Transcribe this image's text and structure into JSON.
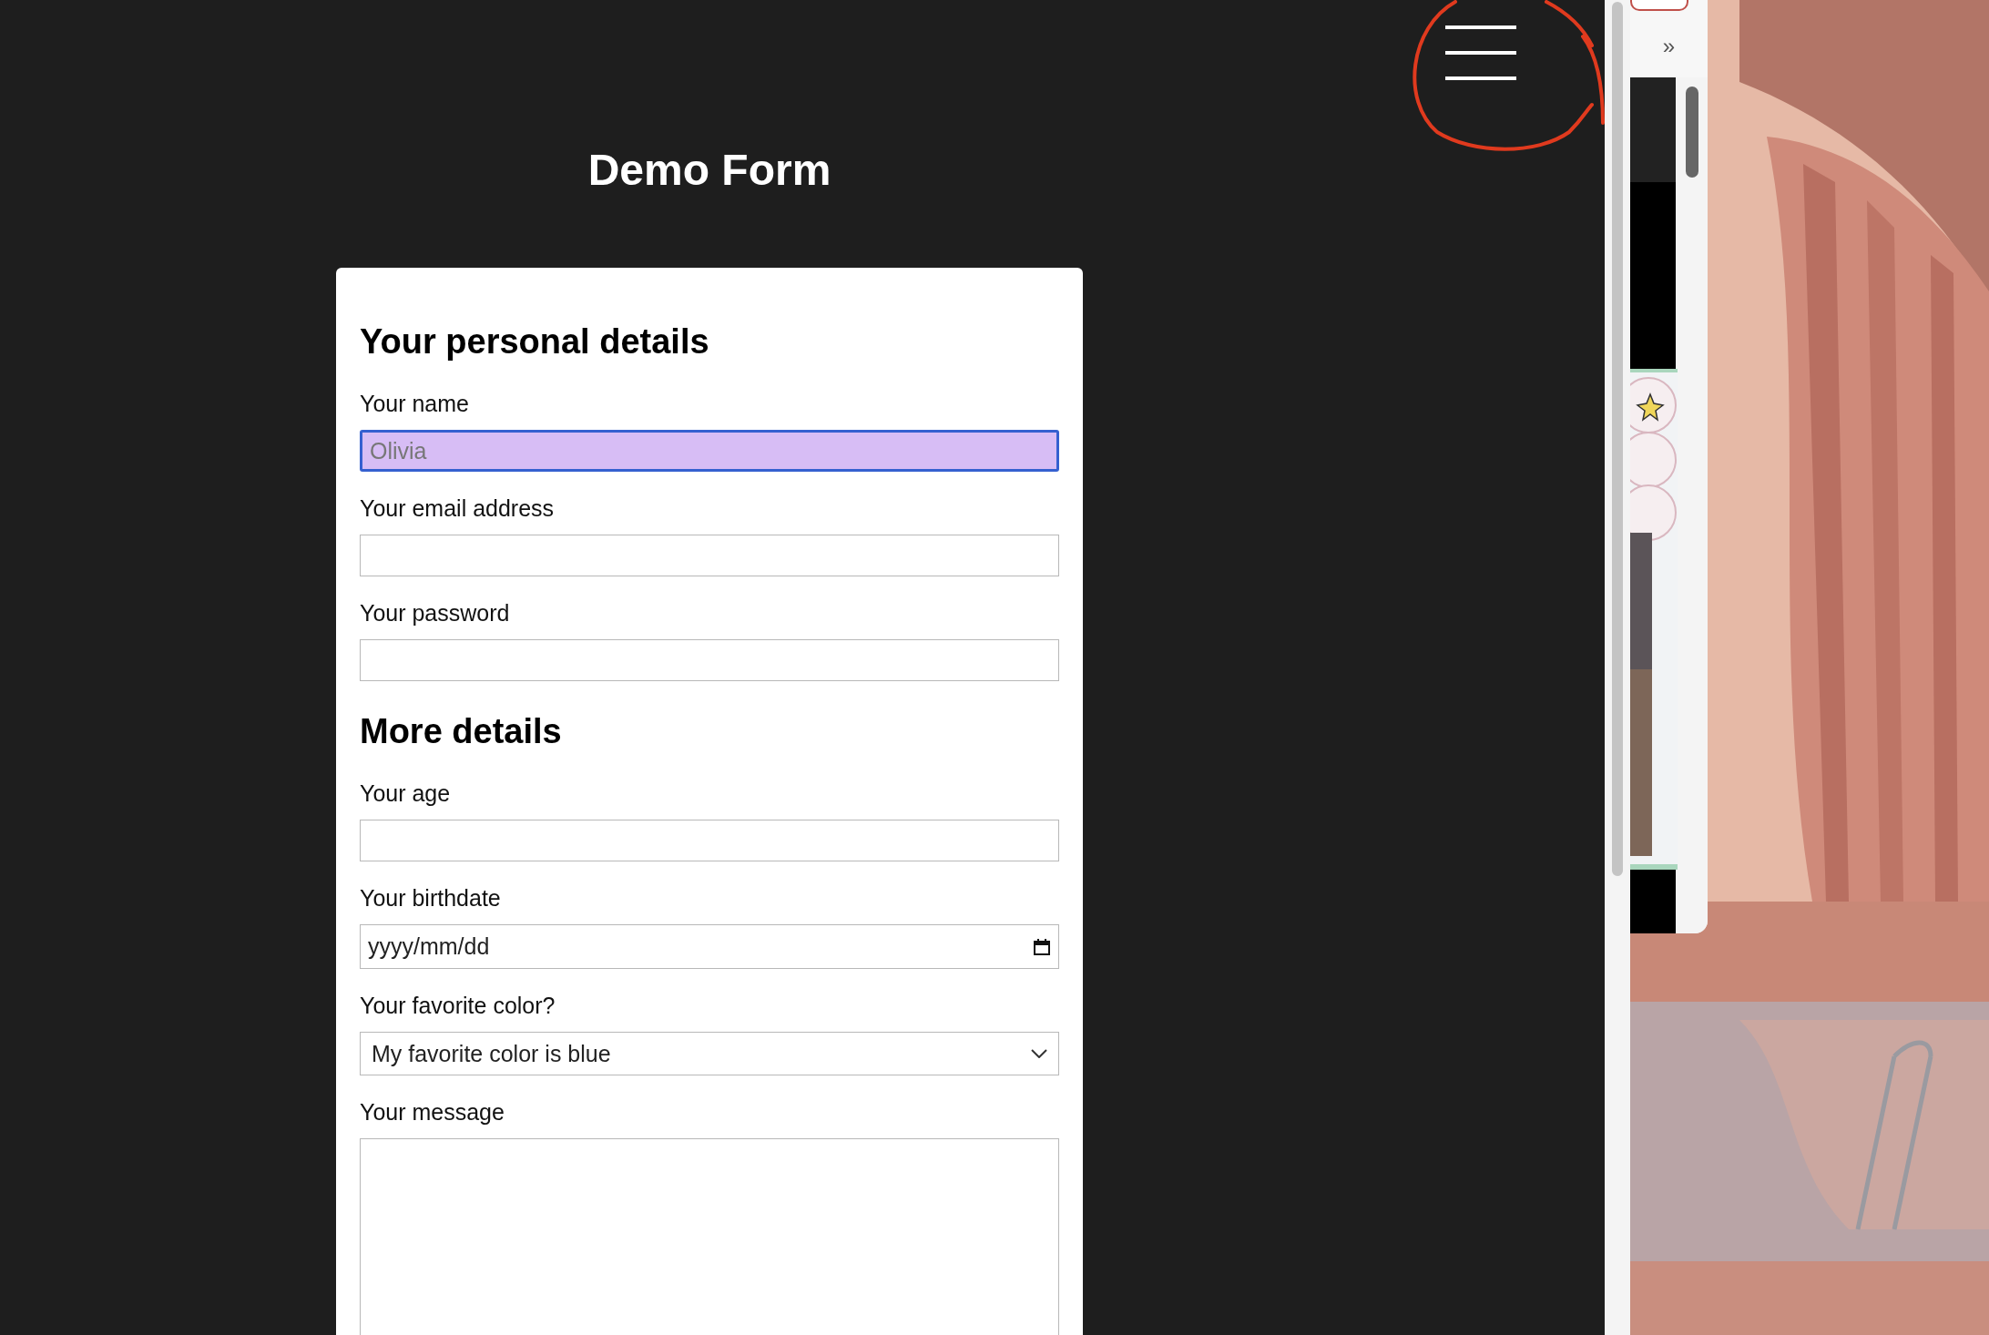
{
  "page": {
    "title": "Demo Form"
  },
  "sections": [
    {
      "heading": "Your personal details",
      "fields": [
        {
          "label": "Your name",
          "kind": "text",
          "placeholder": "Olivia",
          "highlighted": true
        },
        {
          "label": "Your email address",
          "kind": "text",
          "highlighted": false
        },
        {
          "label": "Your password",
          "kind": "text",
          "highlighted": false
        }
      ]
    },
    {
      "heading": "More details",
      "fields": [
        {
          "label": "Your age",
          "kind": "text",
          "highlighted": false
        },
        {
          "label": "Your birthdate",
          "kind": "date",
          "placeholder": "yyyy/mm/dd",
          "highlighted": false
        },
        {
          "label": "Your favorite color?",
          "kind": "select",
          "value": "My favorite color is blue",
          "highlighted": false
        },
        {
          "label": "Your message",
          "kind": "textarea",
          "highlighted": false
        }
      ]
    }
  ],
  "side_window": {
    "overflow_button": "»"
  }
}
